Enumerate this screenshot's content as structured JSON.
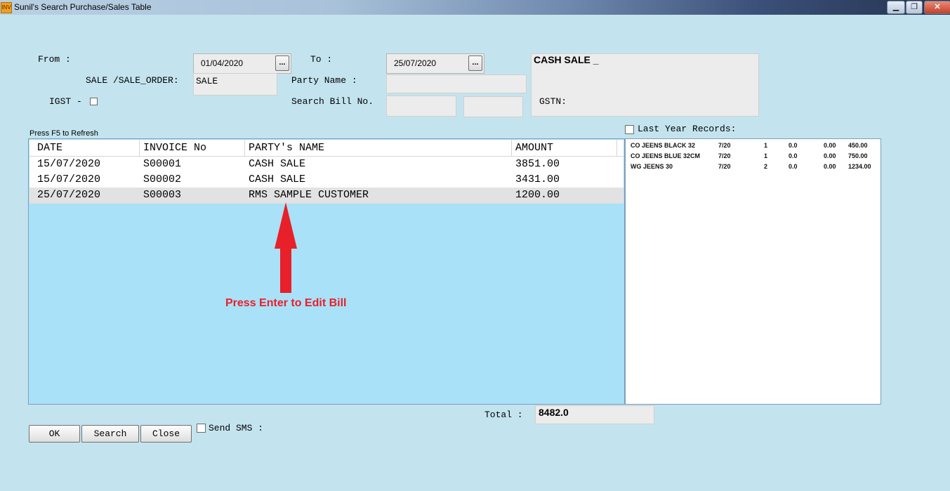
{
  "window": {
    "title": "Sunil's Search Purchase/Sales Table",
    "icon_label": "INV",
    "minimize": "▁",
    "restore": "❐",
    "close": "✕"
  },
  "form": {
    "from_label": "From :",
    "from_date": "01/04/2020",
    "to_label": "To :",
    "to_date": "25/07/2020",
    "browse_label": "...",
    "sale_label": "SALE /SALE_ORDER:",
    "sale_value": "SALE",
    "party_label": "Party Name :",
    "party_value": "",
    "igst_label": "IGST -",
    "search_bill_label": "Search Bill No.",
    "search_bill_value": "",
    "search_bill_value2": "",
    "info_name": "CASH SALE _",
    "gstn_label": "GSTN:",
    "last_year_label": "Last Year Records:",
    "refresh_hint": "Press F5 to Refresh"
  },
  "table": {
    "columns": [
      "DATE",
      "INVOICE No",
      "PARTY's NAME",
      "AMOUNT"
    ],
    "rows": [
      [
        "15/07/2020",
        "S00001",
        "CASH SALE",
        "3851.00"
      ],
      [
        "15/07/2020",
        "S00002",
        "CASH SALE",
        "3431.00"
      ],
      [
        "25/07/2020",
        "S00003",
        "RMS SAMPLE CUSTOMER",
        "1200.00"
      ]
    ]
  },
  "annotation": {
    "text": "Press Enter to Edit Bill",
    "color": "#e8202a"
  },
  "detail": {
    "rows": [
      [
        "CO JEENS BLACK 32",
        "7/20",
        "1",
        "0.0",
        "0.00",
        "450.00"
      ],
      [
        "CO JEENS BLUE 32CM",
        "7/20",
        "1",
        "0.0",
        "0.00",
        "750.00"
      ],
      [
        "WG JEENS 30",
        "7/20",
        "2",
        "0.0",
        "0.00",
        "1234.00"
      ]
    ]
  },
  "footer": {
    "total_label": "Total :",
    "total_value": "8482.0",
    "ok_label": "OK",
    "search_label": "Search",
    "close_label": "Close",
    "sms_label": "Send SMS :"
  },
  "colors": {
    "background": "#c3e4ee",
    "grid_background": "#a9e1f8",
    "selected_row": "#e2e2e2"
  }
}
